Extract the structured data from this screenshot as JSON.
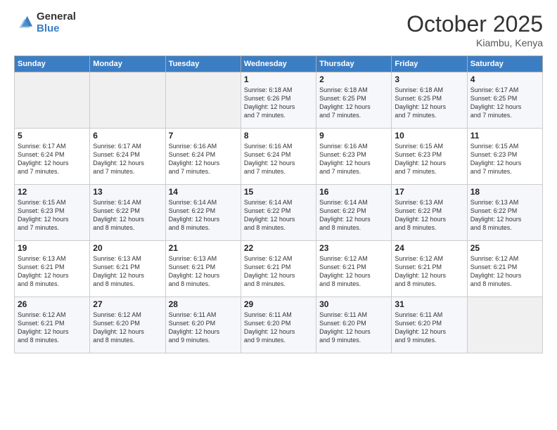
{
  "logo": {
    "general": "General",
    "blue": "Blue"
  },
  "title": "October 2025",
  "subtitle": "Kiambu, Kenya",
  "headers": [
    "Sunday",
    "Monday",
    "Tuesday",
    "Wednesday",
    "Thursday",
    "Friday",
    "Saturday"
  ],
  "weeks": [
    [
      {
        "day": "",
        "info": ""
      },
      {
        "day": "",
        "info": ""
      },
      {
        "day": "",
        "info": ""
      },
      {
        "day": "1",
        "info": "Sunrise: 6:18 AM\nSunset: 6:26 PM\nDaylight: 12 hours\nand 7 minutes."
      },
      {
        "day": "2",
        "info": "Sunrise: 6:18 AM\nSunset: 6:25 PM\nDaylight: 12 hours\nand 7 minutes."
      },
      {
        "day": "3",
        "info": "Sunrise: 6:18 AM\nSunset: 6:25 PM\nDaylight: 12 hours\nand 7 minutes."
      },
      {
        "day": "4",
        "info": "Sunrise: 6:17 AM\nSunset: 6:25 PM\nDaylight: 12 hours\nand 7 minutes."
      }
    ],
    [
      {
        "day": "5",
        "info": "Sunrise: 6:17 AM\nSunset: 6:24 PM\nDaylight: 12 hours\nand 7 minutes."
      },
      {
        "day": "6",
        "info": "Sunrise: 6:17 AM\nSunset: 6:24 PM\nDaylight: 12 hours\nand 7 minutes."
      },
      {
        "day": "7",
        "info": "Sunrise: 6:16 AM\nSunset: 6:24 PM\nDaylight: 12 hours\nand 7 minutes."
      },
      {
        "day": "8",
        "info": "Sunrise: 6:16 AM\nSunset: 6:24 PM\nDaylight: 12 hours\nand 7 minutes."
      },
      {
        "day": "9",
        "info": "Sunrise: 6:16 AM\nSunset: 6:23 PM\nDaylight: 12 hours\nand 7 minutes."
      },
      {
        "day": "10",
        "info": "Sunrise: 6:15 AM\nSunset: 6:23 PM\nDaylight: 12 hours\nand 7 minutes."
      },
      {
        "day": "11",
        "info": "Sunrise: 6:15 AM\nSunset: 6:23 PM\nDaylight: 12 hours\nand 7 minutes."
      }
    ],
    [
      {
        "day": "12",
        "info": "Sunrise: 6:15 AM\nSunset: 6:23 PM\nDaylight: 12 hours\nand 7 minutes."
      },
      {
        "day": "13",
        "info": "Sunrise: 6:14 AM\nSunset: 6:22 PM\nDaylight: 12 hours\nand 8 minutes."
      },
      {
        "day": "14",
        "info": "Sunrise: 6:14 AM\nSunset: 6:22 PM\nDaylight: 12 hours\nand 8 minutes."
      },
      {
        "day": "15",
        "info": "Sunrise: 6:14 AM\nSunset: 6:22 PM\nDaylight: 12 hours\nand 8 minutes."
      },
      {
        "day": "16",
        "info": "Sunrise: 6:14 AM\nSunset: 6:22 PM\nDaylight: 12 hours\nand 8 minutes."
      },
      {
        "day": "17",
        "info": "Sunrise: 6:13 AM\nSunset: 6:22 PM\nDaylight: 12 hours\nand 8 minutes."
      },
      {
        "day": "18",
        "info": "Sunrise: 6:13 AM\nSunset: 6:22 PM\nDaylight: 12 hours\nand 8 minutes."
      }
    ],
    [
      {
        "day": "19",
        "info": "Sunrise: 6:13 AM\nSunset: 6:21 PM\nDaylight: 12 hours\nand 8 minutes."
      },
      {
        "day": "20",
        "info": "Sunrise: 6:13 AM\nSunset: 6:21 PM\nDaylight: 12 hours\nand 8 minutes."
      },
      {
        "day": "21",
        "info": "Sunrise: 6:13 AM\nSunset: 6:21 PM\nDaylight: 12 hours\nand 8 minutes."
      },
      {
        "day": "22",
        "info": "Sunrise: 6:12 AM\nSunset: 6:21 PM\nDaylight: 12 hours\nand 8 minutes."
      },
      {
        "day": "23",
        "info": "Sunrise: 6:12 AM\nSunset: 6:21 PM\nDaylight: 12 hours\nand 8 minutes."
      },
      {
        "day": "24",
        "info": "Sunrise: 6:12 AM\nSunset: 6:21 PM\nDaylight: 12 hours\nand 8 minutes."
      },
      {
        "day": "25",
        "info": "Sunrise: 6:12 AM\nSunset: 6:21 PM\nDaylight: 12 hours\nand 8 minutes."
      }
    ],
    [
      {
        "day": "26",
        "info": "Sunrise: 6:12 AM\nSunset: 6:21 PM\nDaylight: 12 hours\nand 8 minutes."
      },
      {
        "day": "27",
        "info": "Sunrise: 6:12 AM\nSunset: 6:20 PM\nDaylight: 12 hours\nand 8 minutes."
      },
      {
        "day": "28",
        "info": "Sunrise: 6:11 AM\nSunset: 6:20 PM\nDaylight: 12 hours\nand 9 minutes."
      },
      {
        "day": "29",
        "info": "Sunrise: 6:11 AM\nSunset: 6:20 PM\nDaylight: 12 hours\nand 9 minutes."
      },
      {
        "day": "30",
        "info": "Sunrise: 6:11 AM\nSunset: 6:20 PM\nDaylight: 12 hours\nand 9 minutes."
      },
      {
        "day": "31",
        "info": "Sunrise: 6:11 AM\nSunset: 6:20 PM\nDaylight: 12 hours\nand 9 minutes."
      },
      {
        "day": "",
        "info": ""
      }
    ]
  ]
}
